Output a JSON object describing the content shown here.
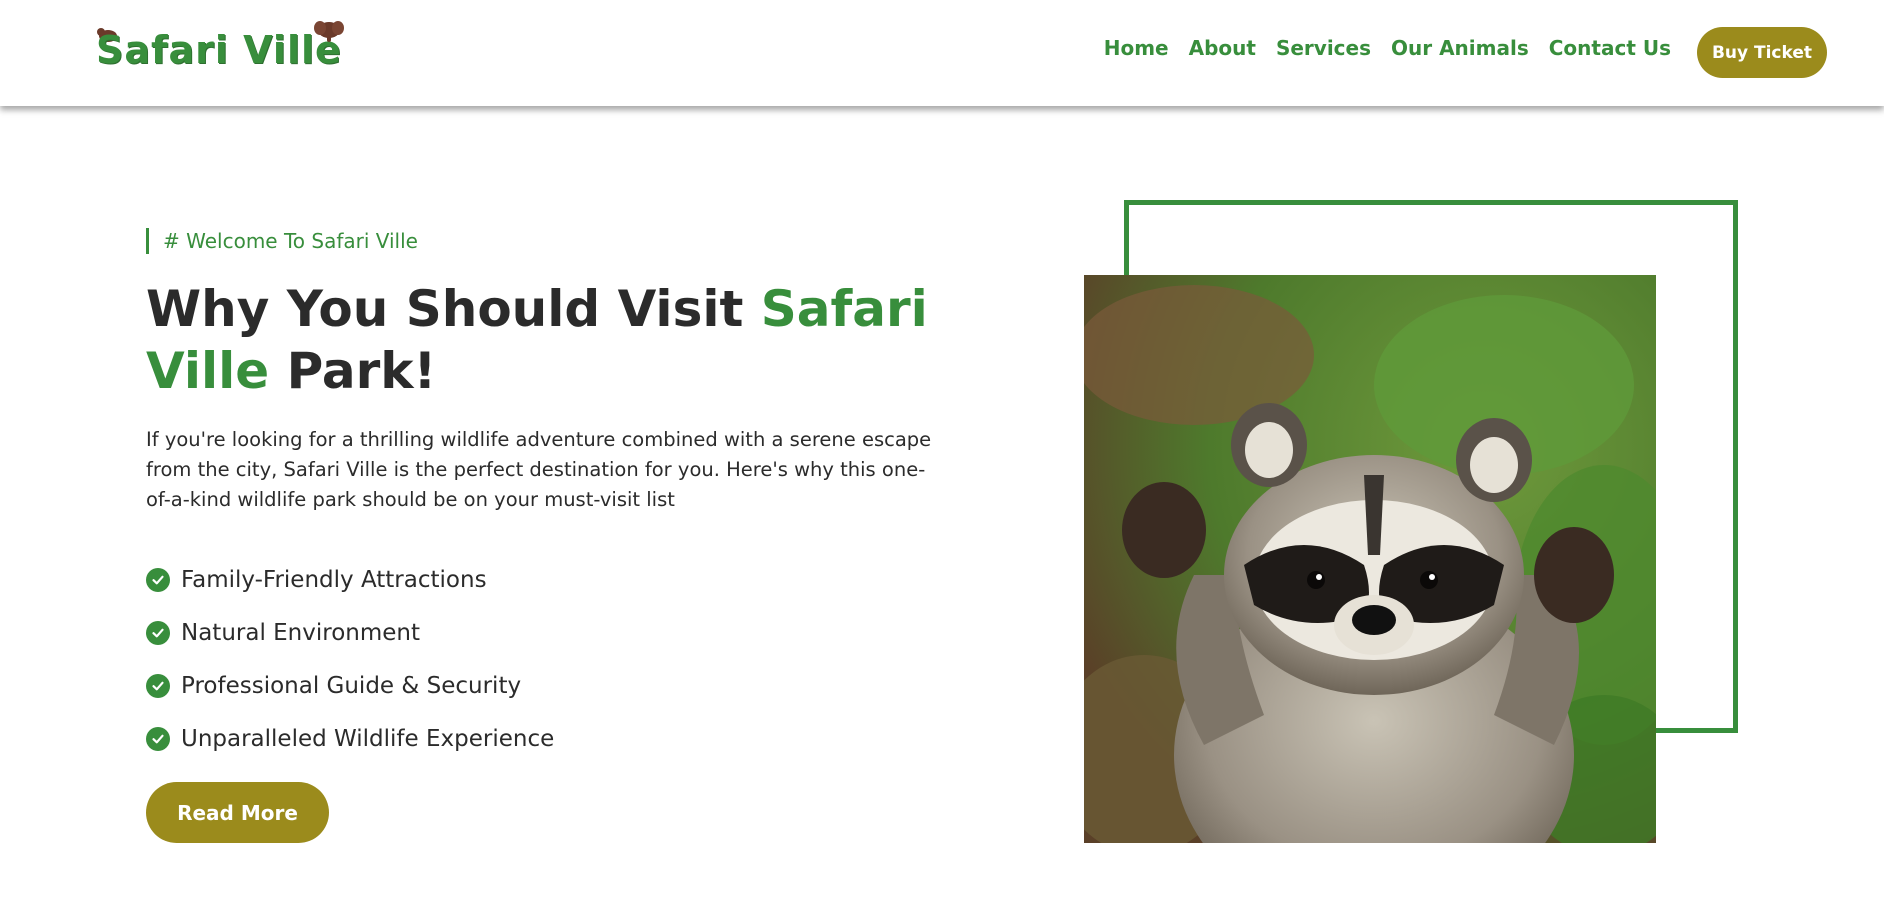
{
  "brand": {
    "name": "Safari Ville",
    "color": "#388e3c",
    "accent_button": "#9b8b1c"
  },
  "nav": {
    "items": [
      {
        "label": "Home"
      },
      {
        "label": "About"
      },
      {
        "label": "Services"
      },
      {
        "label": "Our Animals"
      },
      {
        "label": "Contact Us"
      }
    ],
    "cta": "Buy Ticket"
  },
  "hero": {
    "tagline": "# Welcome To Safari Ville",
    "headline_part1": "Why You Should Visit ",
    "headline_accent": "Safari Ville",
    "headline_part2": " Park!",
    "intro": "If you're looking for a thrilling wildlife adventure combined with a serene escape from the city, Safari Ville is the perfect destination for you. Here's why this one-of-a-kind wildlife park should be on your must-visit list",
    "features": [
      {
        "label": "Family-Friendly Attractions",
        "icon": "check-circle-icon"
      },
      {
        "label": "Natural Environment",
        "icon": "check-circle-icon"
      },
      {
        "label": "Professional Guide & Security",
        "icon": "check-circle-icon"
      },
      {
        "label": "Unparalleled Wildlife Experience",
        "icon": "check-circle-icon"
      }
    ],
    "button": "Read More",
    "image": {
      "subject": "raccoon"
    }
  }
}
